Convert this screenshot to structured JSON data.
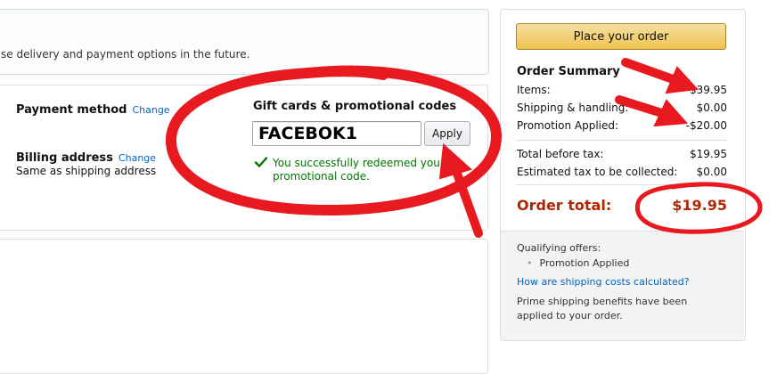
{
  "delivery_notice": "se delivery and payment options in the future.",
  "payment": {
    "method_label": "Payment method",
    "change_label": "Change",
    "billing_label": "Billing address",
    "billing_change_label": "Change",
    "billing_value": "Same as shipping address"
  },
  "gift": {
    "title": "Gift cards & promotional codes",
    "code_value": "FACEBOK1",
    "apply_label": "Apply",
    "success_message": "You successfully redeemed your promotional code."
  },
  "summary": {
    "place_order_label": "Place your order",
    "title": "Order Summary",
    "items_label": "Items:",
    "items_value": "$39.95",
    "shipping_label": "Shipping & handling:",
    "shipping_value": "$0.00",
    "promo_label": "Promotion Applied:",
    "promo_value": "-$20.00",
    "before_tax_label": "Total before tax:",
    "before_tax_value": "$19.95",
    "tax_label": "Estimated tax to be collected:",
    "tax_value": "$0.00",
    "total_label": "Order total:",
    "total_value": "$19.95"
  },
  "footer": {
    "qualifying_label": "Qualifying offers:",
    "qualifying_item": "Promotion Applied",
    "shipping_link": "How are shipping costs calculated?",
    "prime_note": "Prime shipping benefits have been applied to your order."
  },
  "colors": {
    "link": "#0066c0",
    "success": "#007600",
    "order_total": "#b12704",
    "annotation": "#e8191f",
    "place_order_button": "#f0c14b"
  },
  "icons": [
    "check-icon"
  ]
}
